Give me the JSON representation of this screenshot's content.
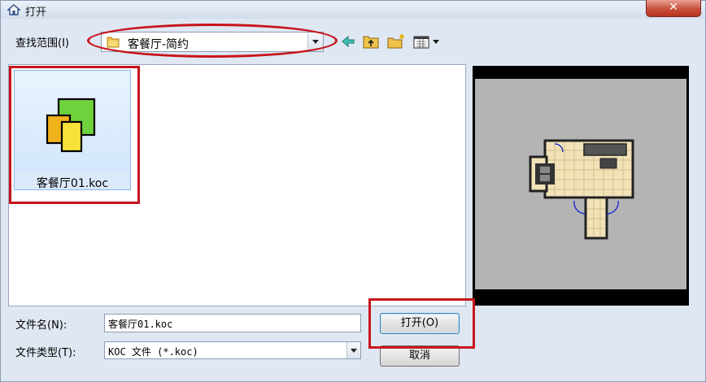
{
  "window": {
    "title": "打开",
    "close_glyph": "✕"
  },
  "look_in": {
    "label": "查找范围(I)",
    "value": "客餐厅-简约"
  },
  "toolbar": {
    "icons": [
      "back-arrow-icon",
      "up-folder-icon",
      "new-folder-icon",
      "view-menu-icon"
    ]
  },
  "files": [
    {
      "name": "客餐厅01.koc",
      "icon": "koc-file-icon"
    }
  ],
  "filename": {
    "label": "文件名(N):",
    "value": "客餐厅01.koc"
  },
  "filetype": {
    "label": "文件类型(T):",
    "value": "KOC 文件 (*.koc)"
  },
  "buttons": {
    "open": "打开(O)",
    "cancel": "取消"
  },
  "colors": {
    "annotation": "#c8141c",
    "selection": "#cfe4fb"
  }
}
